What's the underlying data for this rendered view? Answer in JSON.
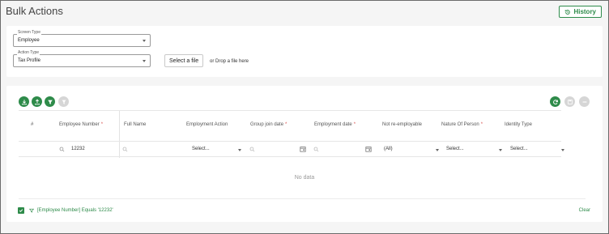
{
  "page": {
    "title": "Bulk Actions",
    "history_label": "History"
  },
  "form": {
    "screen_type": {
      "label": "Screen Type",
      "value": "Employee"
    },
    "action_type": {
      "label": "Action Type",
      "value": "Tax Profile"
    },
    "select_file_label": "Select a file",
    "drop_text": "or Drop a file here"
  },
  "toolbar": {
    "left_icons": [
      "download-icon",
      "upload-icon",
      "filter-icon",
      "clear-filter-icon"
    ],
    "right_icons": [
      "refresh-icon",
      "save-icon",
      "more-icon"
    ]
  },
  "grid": {
    "columns": [
      {
        "title": "#",
        "required": false
      },
      {
        "title": "Employee Number",
        "required": true
      },
      {
        "title": "Full Name",
        "required": false
      },
      {
        "title": "Employment Action",
        "required": false
      },
      {
        "title": "Group join date",
        "required": true
      },
      {
        "title": "Employment date",
        "required": true
      },
      {
        "title": "Not re-employable",
        "required": false
      },
      {
        "title": "Nature Of Person",
        "required": true
      },
      {
        "title": "Identity Type",
        "required": false
      }
    ],
    "required_mark": "*",
    "filters": {
      "employee_number": "12232",
      "employment_action": "Select...",
      "not_reemployable": "(All)",
      "nature_of_person": "Select...",
      "identity_type": "Select..."
    },
    "empty_text": "No data"
  },
  "filter_bar": {
    "enabled": true,
    "expression": "[Employee Number] Equals '12232'",
    "clear_label": "Clear"
  },
  "colors": {
    "accent": "#2e8b4a",
    "required": "#d9534f",
    "disabled": "#d6d6d6"
  }
}
